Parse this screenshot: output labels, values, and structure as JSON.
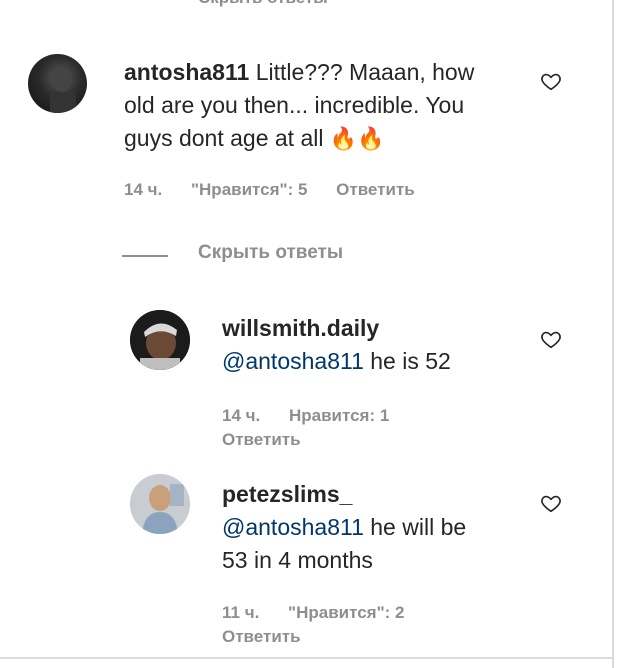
{
  "top_hide_replies": "Скрыть ответы",
  "comments": [
    {
      "username": "antosha811",
      "text_line1": "Little??? Maaan, how",
      "text_line2": "old are you then... incredible. You",
      "text_line3": "guys dont age at all",
      "emoji": "🔥🔥",
      "time": "14 ч.",
      "likes": "\"Нравится\": 5",
      "reply": "Ответить"
    }
  ],
  "hide_replies": "Скрыть ответы",
  "replies": [
    {
      "username": "willsmith.daily",
      "mention": "@antosha811",
      "text": " he is 52",
      "time": "14 ч.",
      "likes": "Нравится: 1",
      "reply": "Ответить"
    },
    {
      "username": "petezslims_",
      "mention": "@antosha811",
      "text": " he will be",
      "text_line2": "53 in 4 months",
      "time": "11 ч.",
      "likes": "\"Нравится\": 2",
      "reply": "Ответить"
    }
  ],
  "colors": {
    "text": "#262626",
    "secondary": "#8e8e8e",
    "mention": "#00376b",
    "flame": "#f77f1a"
  },
  "icons": [
    "heart-icon",
    "fire-emoji"
  ]
}
